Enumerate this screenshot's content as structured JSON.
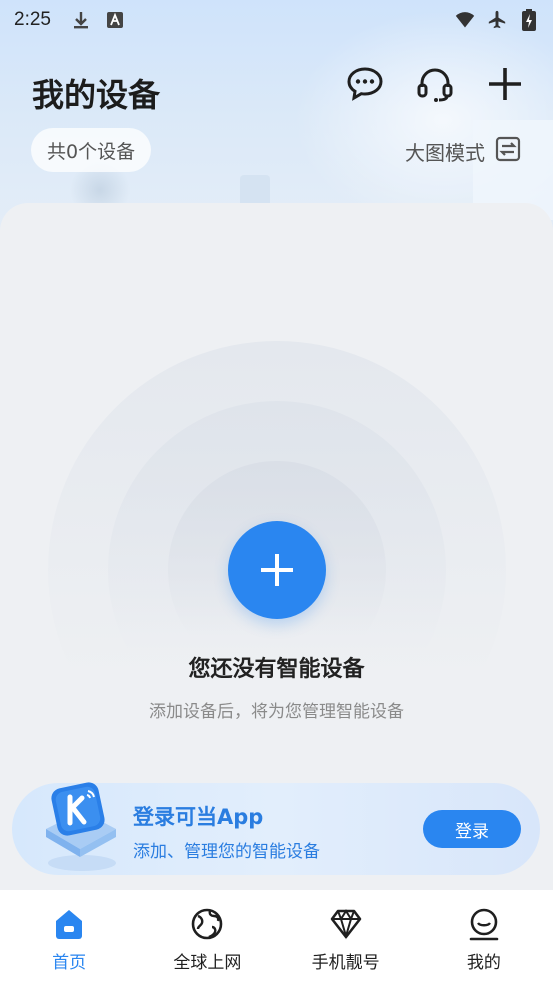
{
  "status_bar": {
    "time": "2:25",
    "left_icons": [
      "download-icon",
      "a-badge-icon"
    ],
    "right_icons": [
      "wifi-icon",
      "airplane-icon",
      "battery-charging-icon"
    ]
  },
  "header": {
    "title": "我的设备",
    "device_count": "共0个设备",
    "view_mode_label": "大图模式",
    "actions": [
      "chat-icon",
      "headset-icon",
      "plus-icon"
    ]
  },
  "empty_state": {
    "title": "您还没有智能设备",
    "subtitle": "添加设备后，将为您管理智能设备"
  },
  "login_banner": {
    "title": "登录可当App",
    "subtitle": "添加、管理您的智能设备",
    "button_label": "登录"
  },
  "bottom_nav": {
    "items": [
      {
        "label": "首页",
        "icon": "home-icon",
        "active": true
      },
      {
        "label": "全球上网",
        "icon": "globe-icon",
        "active": false
      },
      {
        "label": "手机靓号",
        "icon": "diamond-icon",
        "active": false
      },
      {
        "label": "我的",
        "icon": "profile-icon",
        "active": false
      }
    ]
  },
  "colors": {
    "accent": "#2a86f0",
    "banner_text": "#2a7de0",
    "background": "#eef0f3"
  }
}
